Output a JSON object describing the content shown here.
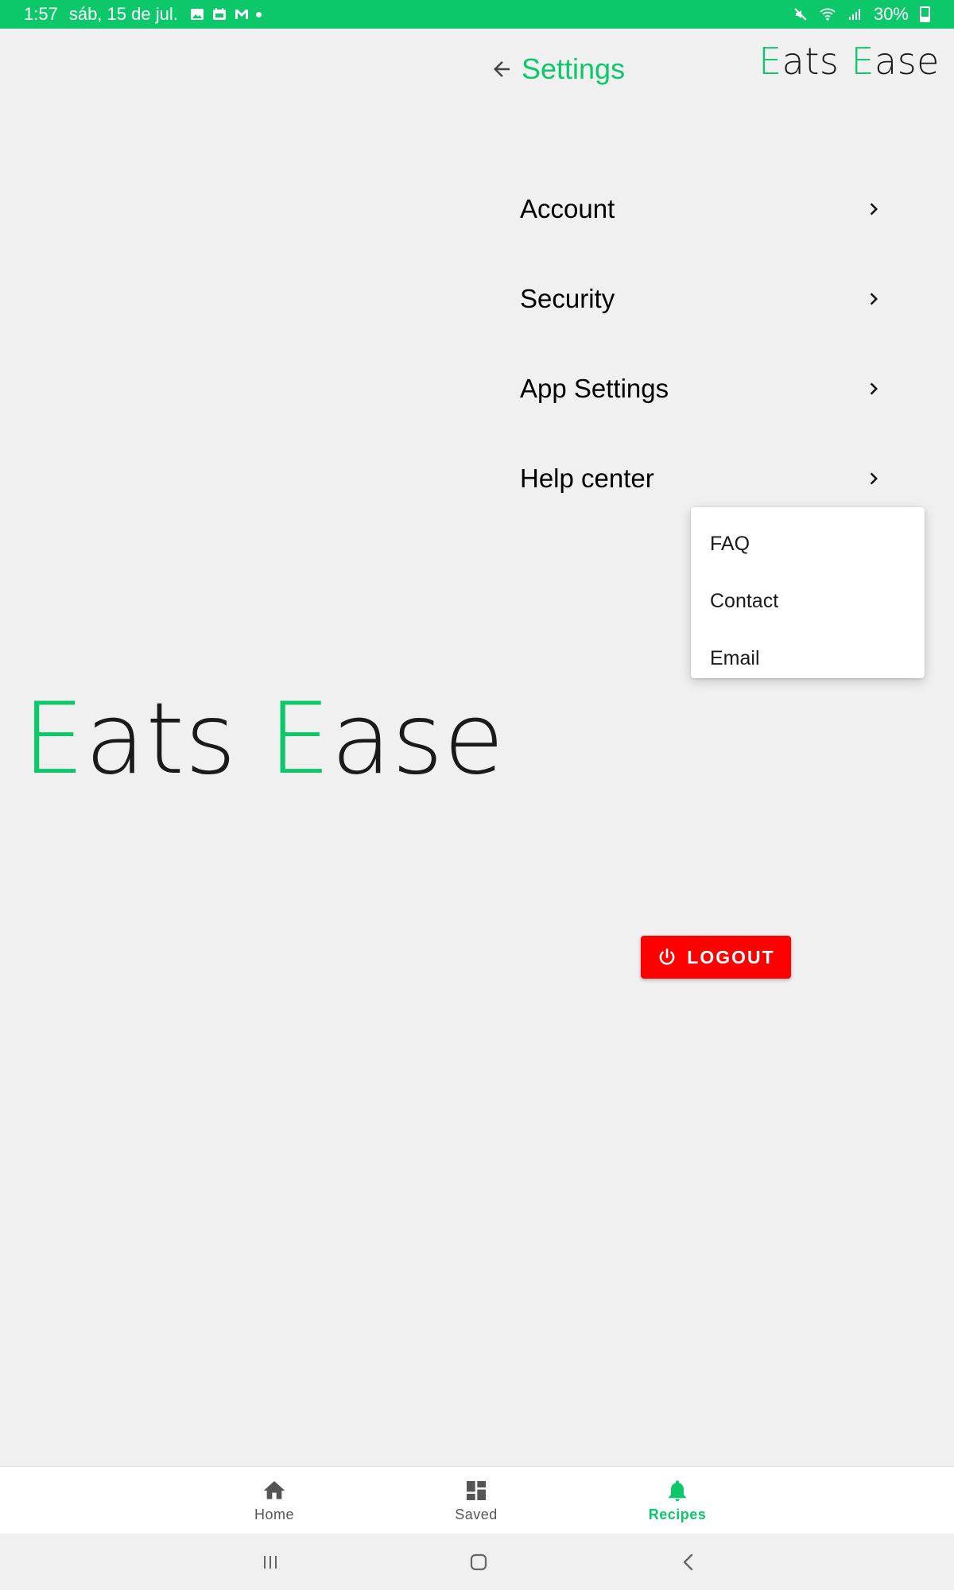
{
  "status_bar": {
    "time": "1:57",
    "date": "sáb, 15 de jul.",
    "battery": "30%",
    "icons": [
      "gallery-icon",
      "calendar-icon",
      "gmail-icon",
      "dot-icon",
      "mute-icon",
      "wifi-icon",
      "signal-icon",
      "battery-icon"
    ]
  },
  "header": {
    "back_icon": "arrow-left-icon",
    "title": "Settings",
    "brand": {
      "first_letter": "E",
      "first_rest": "ats ",
      "second_letter": "E",
      "second_rest": "ase"
    }
  },
  "settings": {
    "items": [
      {
        "label": "Account",
        "icon": "chevron-right-icon"
      },
      {
        "label": "Security",
        "icon": "chevron-right-icon"
      },
      {
        "label": "App Settings",
        "icon": "chevron-right-icon"
      },
      {
        "label": "Help center",
        "icon": "chevron-right-icon"
      }
    ]
  },
  "help_dropdown": {
    "items": [
      "FAQ",
      "Contact",
      "Email"
    ]
  },
  "brand_large": {
    "first_letter": "E",
    "first_rest": "ats ",
    "second_letter": "E",
    "second_rest": "ase"
  },
  "logout": {
    "label": "LOGOUT",
    "icon": "power-icon",
    "color": "#ff0000"
  },
  "bottom_nav": {
    "items": [
      {
        "label": "Home",
        "icon": "home-icon",
        "active": false
      },
      {
        "label": "Saved",
        "icon": "dashboard-icon",
        "active": false
      },
      {
        "label": "Recipes",
        "icon": "bell-icon",
        "active": true
      }
    ]
  },
  "system_nav": {
    "icons": [
      "recents-icon",
      "home-circle-icon",
      "back-chevron-icon"
    ]
  },
  "colors": {
    "accent": "#0cc86a",
    "background": "#f0f0f0",
    "logout": "#ff0000"
  }
}
